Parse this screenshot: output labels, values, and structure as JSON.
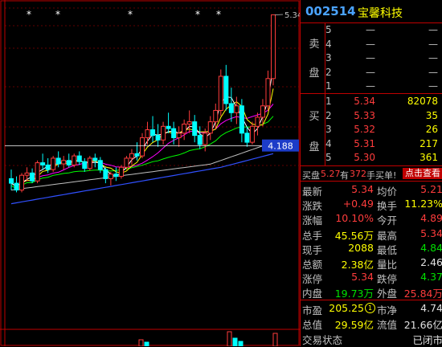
{
  "stock": {
    "code": "002514",
    "name": "宝馨科技"
  },
  "chart": {
    "high_label": "5.34",
    "price_tag": "4.188",
    "cursor_price": 4.188,
    "price_range": [
      3.55,
      5.4
    ],
    "star_marks": 6,
    "colors": {
      "up": "#ff3c3c",
      "down": "#00ffff",
      "ma5": "#ffffff",
      "ma10": "#ffff00",
      "ma20": "#ff00ff",
      "ma60": "#00ff00",
      "ma120": "#c0c0c0",
      "ma250": "#3050ff",
      "grid": "#c00000"
    },
    "candles": [
      [
        3.9,
        3.98,
        3.8,
        3.86
      ],
      [
        3.86,
        3.92,
        3.78,
        3.8
      ],
      [
        3.8,
        3.95,
        3.78,
        3.93
      ],
      [
        3.93,
        4.0,
        3.88,
        3.95
      ],
      [
        3.95,
        3.99,
        3.86,
        3.88
      ],
      [
        3.88,
        4.06,
        3.86,
        4.04
      ],
      [
        4.04,
        4.12,
        3.98,
        4.02
      ],
      [
        4.02,
        4.08,
        3.95,
        3.98
      ],
      [
        3.98,
        4.1,
        3.96,
        4.08
      ],
      [
        4.08,
        4.14,
        4.0,
        4.03
      ],
      [
        4.03,
        4.1,
        3.98,
        4.06
      ],
      [
        4.06,
        4.12,
        4.0,
        4.02
      ],
      [
        4.02,
        4.12,
        4.0,
        4.1
      ],
      [
        4.1,
        4.14,
        4.02,
        4.05
      ],
      [
        4.05,
        4.08,
        3.96,
        3.99
      ],
      [
        3.99,
        4.1,
        3.97,
        4.08
      ],
      [
        4.08,
        4.12,
        4.0,
        4.06
      ],
      [
        4.06,
        4.09,
        3.95,
        3.98
      ],
      [
        3.98,
        4.0,
        3.86,
        3.9
      ],
      [
        3.9,
        3.96,
        3.84,
        3.94
      ],
      [
        3.94,
        4.0,
        3.88,
        3.92
      ],
      [
        3.92,
        4.02,
        3.9,
        4.0
      ],
      [
        4.0,
        4.1,
        3.98,
        4.08
      ],
      [
        4.08,
        4.16,
        4.02,
        4.12
      ],
      [
        4.12,
        4.22,
        4.06,
        4.1
      ],
      [
        4.1,
        4.3,
        4.08,
        4.26
      ],
      [
        4.26,
        4.4,
        4.2,
        4.33
      ],
      [
        4.33,
        4.45,
        4.22,
        4.28
      ],
      [
        4.28,
        4.38,
        4.18,
        4.24
      ],
      [
        4.24,
        4.4,
        4.2,
        4.36
      ],
      [
        4.36,
        4.48,
        4.3,
        4.34
      ],
      [
        4.34,
        4.4,
        4.2,
        4.26
      ],
      [
        4.26,
        4.36,
        4.18,
        4.3
      ],
      [
        4.3,
        4.42,
        4.24,
        4.38
      ],
      [
        4.38,
        4.5,
        4.3,
        4.4
      ],
      [
        4.4,
        4.46,
        4.22,
        4.28
      ],
      [
        4.28,
        4.36,
        4.16,
        4.2
      ],
      [
        4.2,
        4.34,
        4.14,
        4.3
      ],
      [
        4.3,
        4.45,
        4.24,
        4.4
      ],
      [
        4.4,
        4.56,
        4.34,
        4.5
      ],
      [
        4.5,
        4.86,
        4.45,
        4.8
      ],
      [
        4.8,
        4.9,
        4.5,
        4.56
      ],
      [
        4.56,
        4.7,
        4.4,
        4.48
      ],
      [
        4.48,
        4.62,
        4.38,
        4.54
      ],
      [
        4.54,
        4.6,
        4.22,
        4.3
      ],
      [
        4.3,
        4.36,
        4.18,
        4.22
      ],
      [
        4.22,
        4.4,
        4.2,
        4.36
      ],
      [
        4.36,
        4.48,
        4.28,
        4.44
      ],
      [
        4.44,
        4.6,
        4.36,
        4.54
      ],
      [
        4.54,
        4.85,
        4.5,
        4.78
      ],
      [
        4.78,
        5.34,
        4.72,
        5.34
      ]
    ]
  },
  "order_book": {
    "sell_label": "卖\n\n盘",
    "buy_label": "买\n\n盘",
    "sell": [
      {
        "level": "5",
        "price": "—",
        "volume": "—"
      },
      {
        "level": "4",
        "price": "—",
        "volume": "—"
      },
      {
        "level": "3",
        "price": "—",
        "volume": "—"
      },
      {
        "level": "2",
        "price": "—",
        "volume": "—"
      },
      {
        "level": "1",
        "price": "—",
        "volume": "—"
      }
    ],
    "buy": [
      {
        "level": "1",
        "price": "5.34",
        "volume": "82078"
      },
      {
        "level": "2",
        "price": "5.33",
        "volume": "35"
      },
      {
        "level": "3",
        "price": "5.32",
        "volume": "26"
      },
      {
        "level": "4",
        "price": "5.31",
        "volume": "217"
      },
      {
        "level": "5",
        "price": "5.30",
        "volume": "361"
      }
    ]
  },
  "summary_line": {
    "prefix": "买盘",
    "price": "5.27",
    "mid": "有",
    "count": "372",
    "suffix": "手买单!",
    "button": "点击查看"
  },
  "quote": [
    {
      "l1": "最新",
      "v1": "5.34",
      "c1": "red",
      "l2": "均价",
      "v2": "5.21",
      "c2": "red"
    },
    {
      "l1": "涨跌",
      "v1": "+0.49",
      "c1": "red",
      "l2": "换手",
      "v2": "11.23%",
      "c2": "yellow"
    },
    {
      "l1": "涨幅",
      "v1": "10.10%",
      "c1": "red",
      "l2": "今开",
      "v2": "4.89",
      "c2": "red"
    },
    {
      "l1": "总手",
      "v1": "45.56万",
      "c1": "yellow",
      "l2": "最高",
      "v2": "5.34",
      "c2": "red"
    },
    {
      "l1": "现手",
      "v1": "2088",
      "c1": "yellow",
      "l2": "最低",
      "v2": "4.84",
      "c2": "green"
    },
    {
      "l1": "总额",
      "v1": "2.38亿",
      "c1": "yellow",
      "l2": "量比",
      "v2": "2.46",
      "c2": "white"
    },
    {
      "l1": "涨停",
      "v1": "5.34",
      "c1": "red",
      "l2": "跌停",
      "v2": "4.37",
      "c2": "green"
    },
    {
      "l1": "内盘",
      "v1": "19.73万",
      "c1": "green",
      "l2": "外盘",
      "v2": "25.84万",
      "c2": "red"
    }
  ],
  "fundamentals": [
    {
      "l1": "市盈",
      "v1": "205.25",
      "badge": "①",
      "l2": "市净",
      "v2": "4.74"
    },
    {
      "l1": "总值",
      "v1": "29.59亿",
      "badge": "",
      "l2": "流值",
      "v2": "21.66亿"
    },
    {
      "l1": "交易状态",
      "v1": "",
      "badge": "",
      "l2": "",
      "v2": "已闭市"
    }
  ]
}
